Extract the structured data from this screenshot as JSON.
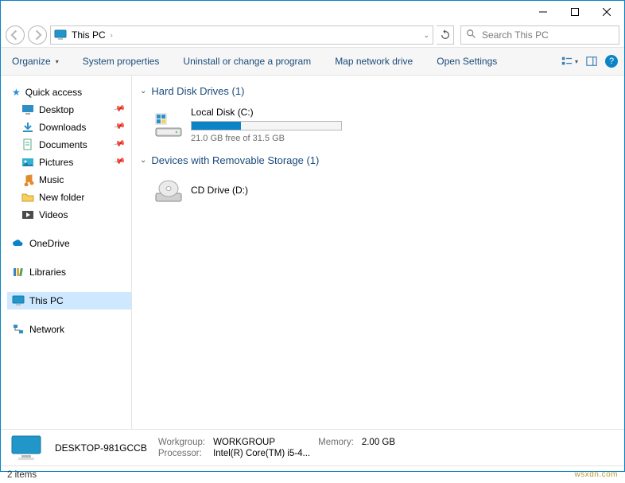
{
  "breadcrumb": {
    "location": "This PC"
  },
  "search": {
    "placeholder": "Search This PC"
  },
  "toolbar": {
    "organize": "Organize",
    "sys_props": "System properties",
    "uninstall": "Uninstall or change a program",
    "map_drive": "Map network drive",
    "open_settings": "Open Settings"
  },
  "sidebar": {
    "quick_access": "Quick access",
    "desktop": "Desktop",
    "downloads": "Downloads",
    "documents": "Documents",
    "pictures": "Pictures",
    "music": "Music",
    "new_folder": "New folder",
    "videos": "Videos",
    "onedrive": "OneDrive",
    "libraries": "Libraries",
    "this_pc": "This PC",
    "network": "Network"
  },
  "sections": {
    "hdd": {
      "title": "Hard Disk Drives (1)"
    },
    "removable": {
      "title": "Devices with Removable Storage (1)"
    }
  },
  "drives": {
    "local": {
      "name": "Local Disk (C:)",
      "free": "21.0 GB free of 31.5 GB",
      "used_pct": 33
    },
    "cd": {
      "name": "CD Drive (D:)"
    }
  },
  "details": {
    "computer_name": "DESKTOP-981GCCB",
    "workgroup_label": "Workgroup:",
    "workgroup": "WORKGROUP",
    "memory_label": "Memory:",
    "memory": "2.00 GB",
    "processor_label": "Processor:",
    "processor": "Intel(R) Core(TM) i5-4..."
  },
  "status": {
    "items": "2 items",
    "watermark": "wsxdn.com"
  }
}
